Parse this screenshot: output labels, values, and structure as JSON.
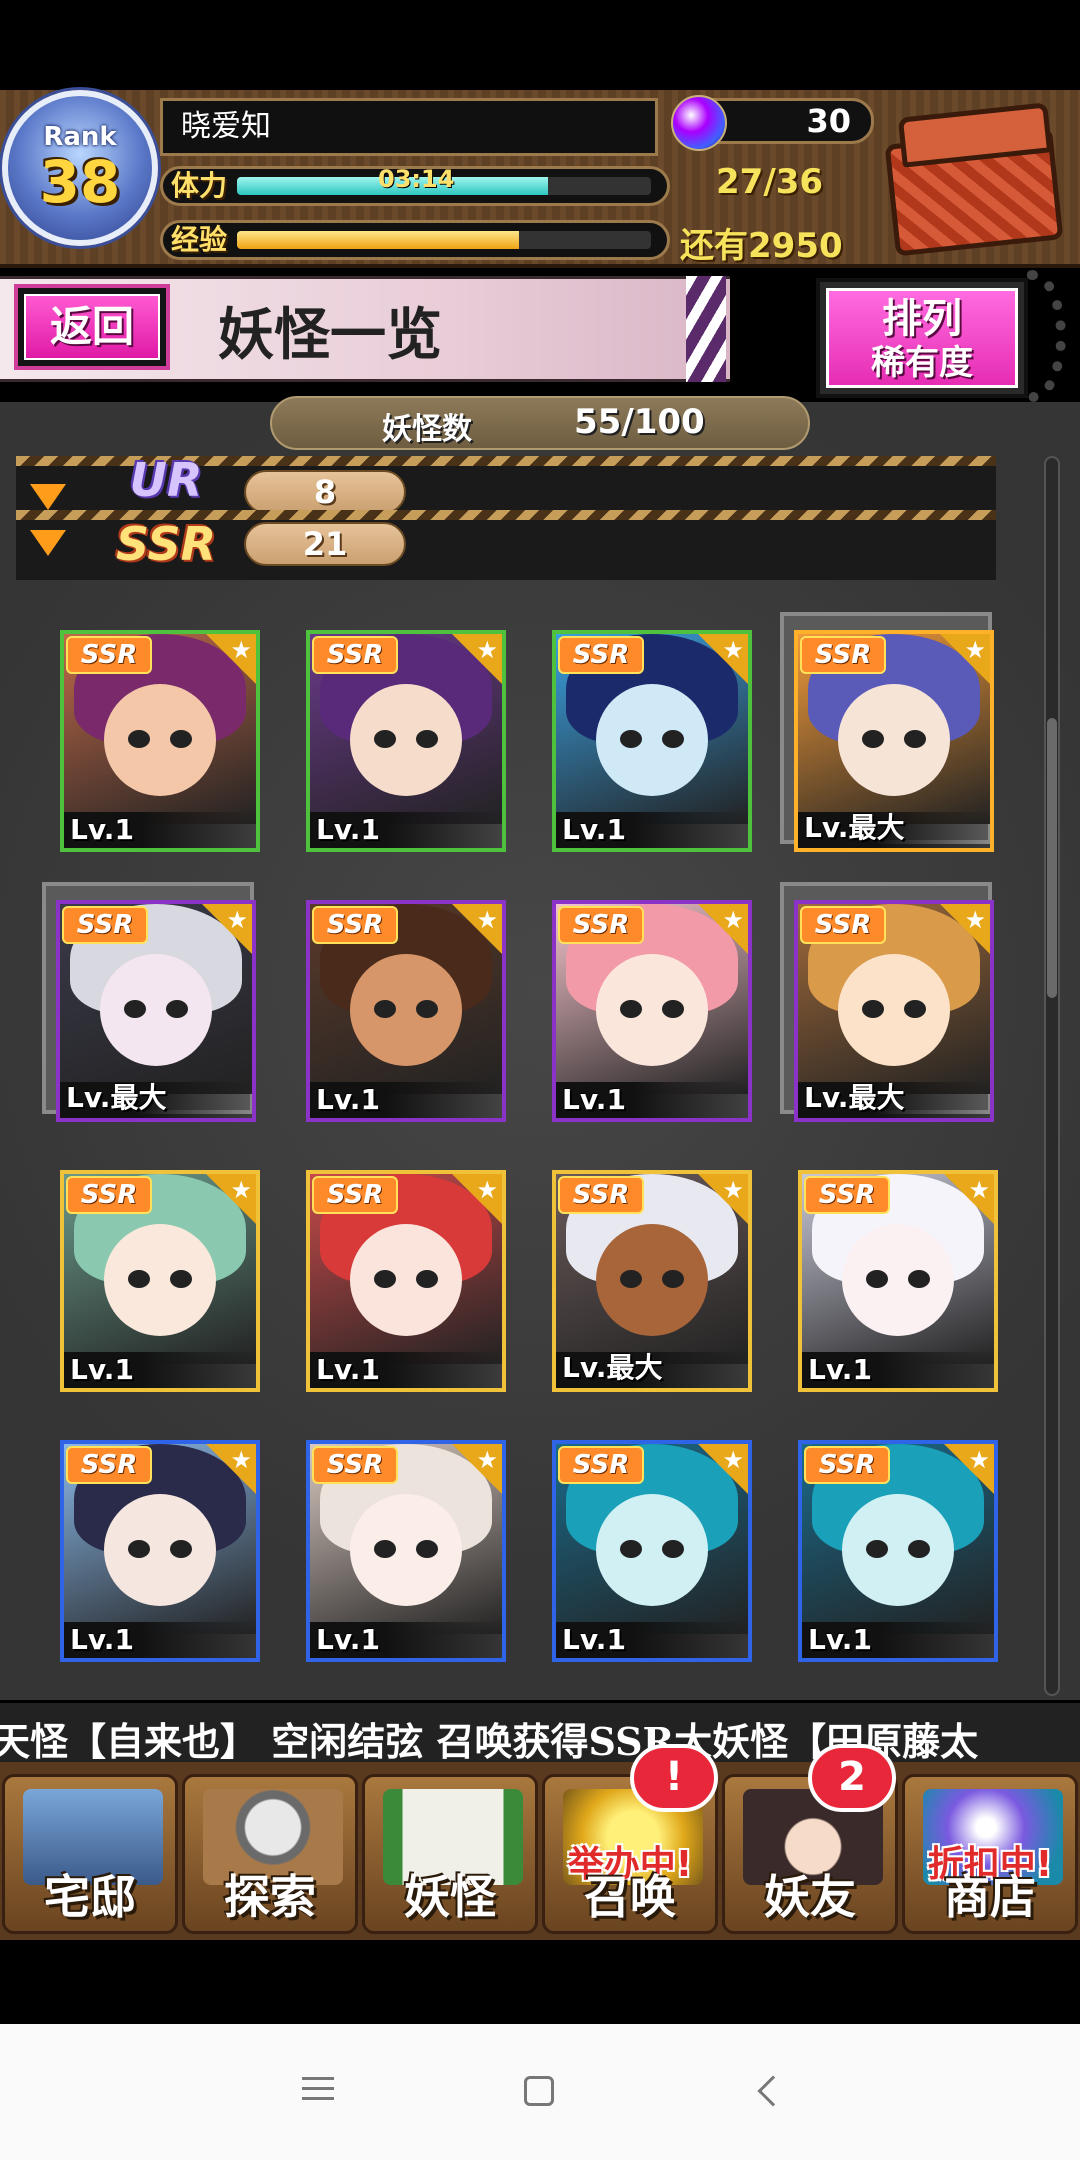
{
  "header": {
    "rank_word": "Rank",
    "rank_number": "38",
    "player_name": "晓爱知",
    "stamina_label": "体力",
    "stamina_timer": "03:14",
    "stamina_count": "27/36",
    "stamina_fraction": 0.75,
    "exp_label": "经验",
    "exp_remaining": "还有2950",
    "exp_fraction": 0.68,
    "gem_count": "30",
    "gem_icon": "crystal-orb-icon",
    "chest_icon": "treasure-chest-icon"
  },
  "title_row": {
    "back_label": "返回",
    "page_title": "妖怪一览",
    "sort_title": "排列",
    "sort_mode": "稀有度"
  },
  "collection": {
    "count_label": "妖怪数",
    "count_value": "55/100",
    "rarity_groups": [
      {
        "label": "UR",
        "count": "8"
      },
      {
        "label": "SSR",
        "count": "21"
      }
    ]
  },
  "cards": [
    {
      "rarity": "SSR",
      "level": "Lv.1",
      "frame": "green",
      "selected": false,
      "hair": "#7a2a6a",
      "skin": "#f4c7a8",
      "bg": "#c06a4a"
    },
    {
      "rarity": "SSR",
      "level": "Lv.1",
      "frame": "green",
      "selected": false,
      "hair": "#5a2a7a",
      "skin": "#f6dccb",
      "bg": "#6a3a8a"
    },
    {
      "rarity": "SSR",
      "level": "Lv.1",
      "frame": "green",
      "selected": false,
      "hair": "#1a2a6a",
      "skin": "#cfe9f6",
      "bg": "#3aa0e0"
    },
    {
      "rarity": "SSR",
      "level": "Lv.最大",
      "frame": "orange",
      "selected": true,
      "hair": "#5a5ab8",
      "skin": "#f6e4d6",
      "bg": "#f09a3a"
    },
    {
      "rarity": "SSR",
      "level": "Lv.最大",
      "frame": "purple",
      "selected": true,
      "hair": "#d8d8e0",
      "skin": "#f4e6f0",
      "bg": "#3a3a4a"
    },
    {
      "rarity": "SSR",
      "level": "Lv.1",
      "frame": "purple",
      "selected": false,
      "hair": "#4a2a1a",
      "skin": "#d7956a",
      "bg": "#5a3a2a"
    },
    {
      "rarity": "SSR",
      "level": "Lv.1",
      "frame": "purple",
      "selected": false,
      "hair": "#f29aa8",
      "skin": "#fbe6dc",
      "bg": "#f4c4cc"
    },
    {
      "rarity": "SSR",
      "level": "Lv.最大",
      "frame": "purple",
      "selected": true,
      "hair": "#d99a4a",
      "skin": "#fbe2c8",
      "bg": "#a06a3a"
    },
    {
      "rarity": "SSR",
      "level": "Lv.1",
      "frame": "gold",
      "selected": false,
      "hair": "#8ac8b0",
      "skin": "#fbe8dc",
      "bg": "#6a9a8a"
    },
    {
      "rarity": "SSR",
      "level": "Lv.1",
      "frame": "gold",
      "selected": false,
      "hair": "#d83a3a",
      "skin": "#fbe4dc",
      "bg": "#c84a4a"
    },
    {
      "rarity": "SSR",
      "level": "Lv.最大",
      "frame": "gold",
      "selected": false,
      "hair": "#e8e8f0",
      "skin": "#a8653a",
      "bg": "#6a5a5a"
    },
    {
      "rarity": "SSR",
      "level": "Lv.1",
      "frame": "gold",
      "selected": false,
      "hair": "#f4f4fa",
      "skin": "#fbf0f2",
      "bg": "#c8c8d8"
    },
    {
      "rarity": "SSR",
      "level": "Lv.1",
      "frame": "blue",
      "selected": false,
      "hair": "#2a2a4a",
      "skin": "#f6e6e0",
      "bg": "#8ab8e8"
    },
    {
      "rarity": "SSR",
      "level": "Lv.1",
      "frame": "blue",
      "selected": false,
      "hair": "#ece4dc",
      "skin": "#fbeee8",
      "bg": "#d8c8c0"
    },
    {
      "rarity": "SSR",
      "level": "Lv.1",
      "frame": "blue",
      "selected": false,
      "hair": "#1aa0b8",
      "skin": "#d0f0f4",
      "bg": "#1a6a8a"
    },
    {
      "rarity": "SSR",
      "level": "Lv.1",
      "frame": "blue",
      "selected": false,
      "hair": "#1aa0b8",
      "skin": "#d0f0f4",
      "bg": "#1a6a8a"
    }
  ],
  "ticker": {
    "text": "天怪【自来也】   空闲结弦 召唤获得SSR大妖怪【田原藤太"
  },
  "bottom_nav": [
    {
      "label": "宅邸",
      "icon": "mansion-icon",
      "tag": "",
      "badge": ""
    },
    {
      "label": "探索",
      "icon": "magnifier-map-icon",
      "tag": "",
      "badge": ""
    },
    {
      "label": "妖怪",
      "icon": "scroll-icon",
      "tag": "",
      "badge": ""
    },
    {
      "label": "召唤",
      "icon": "summon-star-icon",
      "tag": "举办中!",
      "badge": "!"
    },
    {
      "label": "妖友",
      "icon": "friend-avatar-icon",
      "tag": "",
      "badge": "2"
    },
    {
      "label": "商店",
      "icon": "shop-orb-icon",
      "tag": "折扣中!",
      "badge": ""
    }
  ],
  "system_nav": {
    "menu_icon": "menu-icon",
    "home_icon": "home-square-icon",
    "back_icon": "back-chevron-icon"
  }
}
